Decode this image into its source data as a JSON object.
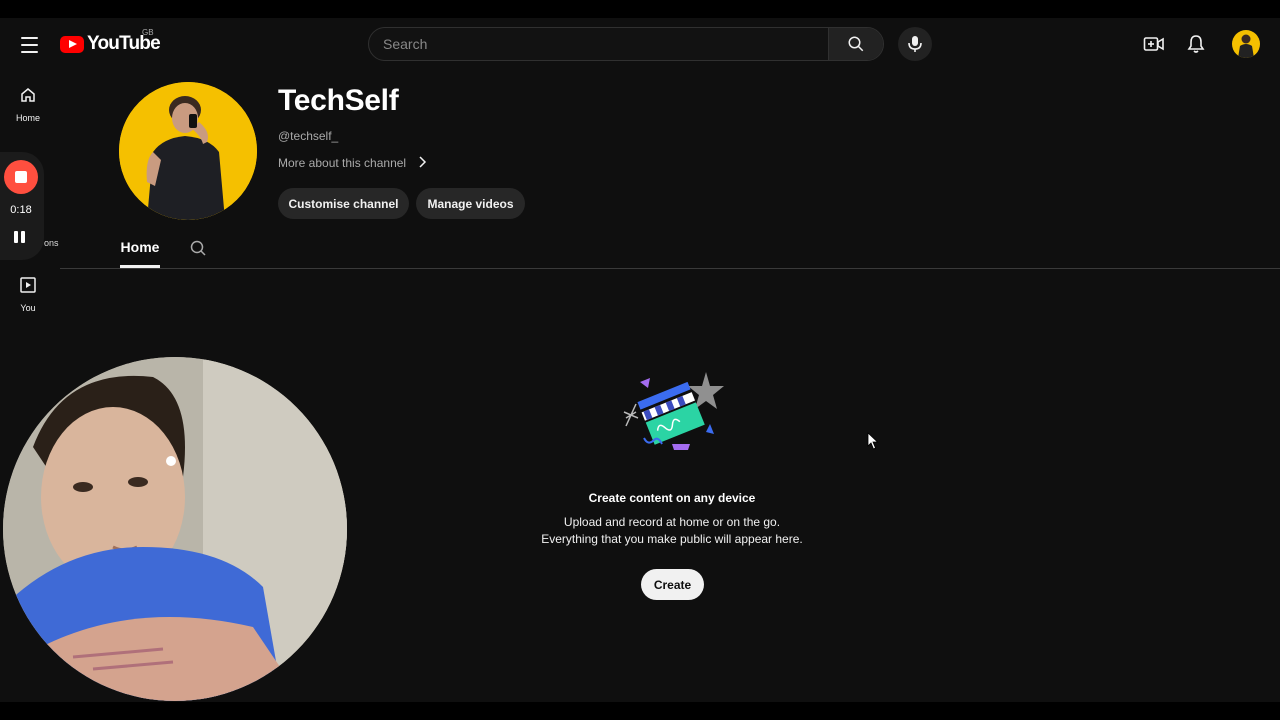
{
  "header": {
    "logo_text": "YouTube",
    "country_code": "GB",
    "search_placeholder": "Search",
    "icons": [
      "menu-icon",
      "search-icon",
      "mic-icon",
      "create-video-icon",
      "notifications-icon"
    ]
  },
  "sidebar": {
    "items": [
      {
        "label": "Home",
        "icon": "home-icon"
      },
      {
        "label": "You",
        "icon": "you-icon"
      }
    ],
    "partial_label": "ons"
  },
  "recorder": {
    "time": "0:18"
  },
  "channel": {
    "name": "TechSelf",
    "handle": "@techself_",
    "more_link": "More about this channel",
    "customise_label": "Customise channel",
    "manage_label": "Manage videos"
  },
  "tabs": {
    "home_label": "Home"
  },
  "empty_state": {
    "title": "Create content on any device",
    "line1": "Upload and record at home or on the go.",
    "line2": "Everything that you make public will appear here.",
    "button_label": "Create"
  },
  "colors": {
    "background": "#0f0f0f",
    "youtube_red": "#ff0000",
    "avatar_yellow": "#f5c000",
    "recorder_red": "#ff4f3f"
  }
}
